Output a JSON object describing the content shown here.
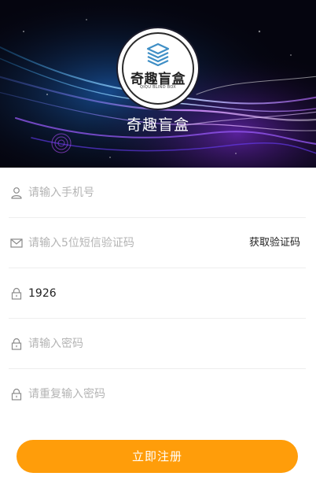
{
  "header": {
    "app_name": "奇趣盲盒",
    "logo_name": "奇趣盲盒",
    "logo_subtitle": "QIQU BLIND BOX"
  },
  "form": {
    "phone": {
      "icon": "user-icon",
      "value": "",
      "placeholder": "请输入手机号"
    },
    "sms_code": {
      "icon": "mail-icon",
      "value": "",
      "placeholder": "请输入5位短信验证码",
      "button_label": "获取验证码"
    },
    "invite_code": {
      "icon": "lock-icon",
      "value": "1926",
      "placeholder": ""
    },
    "password": {
      "icon": "lock-icon",
      "value": "",
      "placeholder": "请输入密码"
    },
    "confirm_password": {
      "icon": "lock-icon",
      "value": "",
      "placeholder": "请重复输入密码"
    },
    "submit_label": "立即注册"
  },
  "colors": {
    "accent": "#ff9d0a",
    "placeholder": "#b4b4b4",
    "divider": "#eeeeee"
  }
}
